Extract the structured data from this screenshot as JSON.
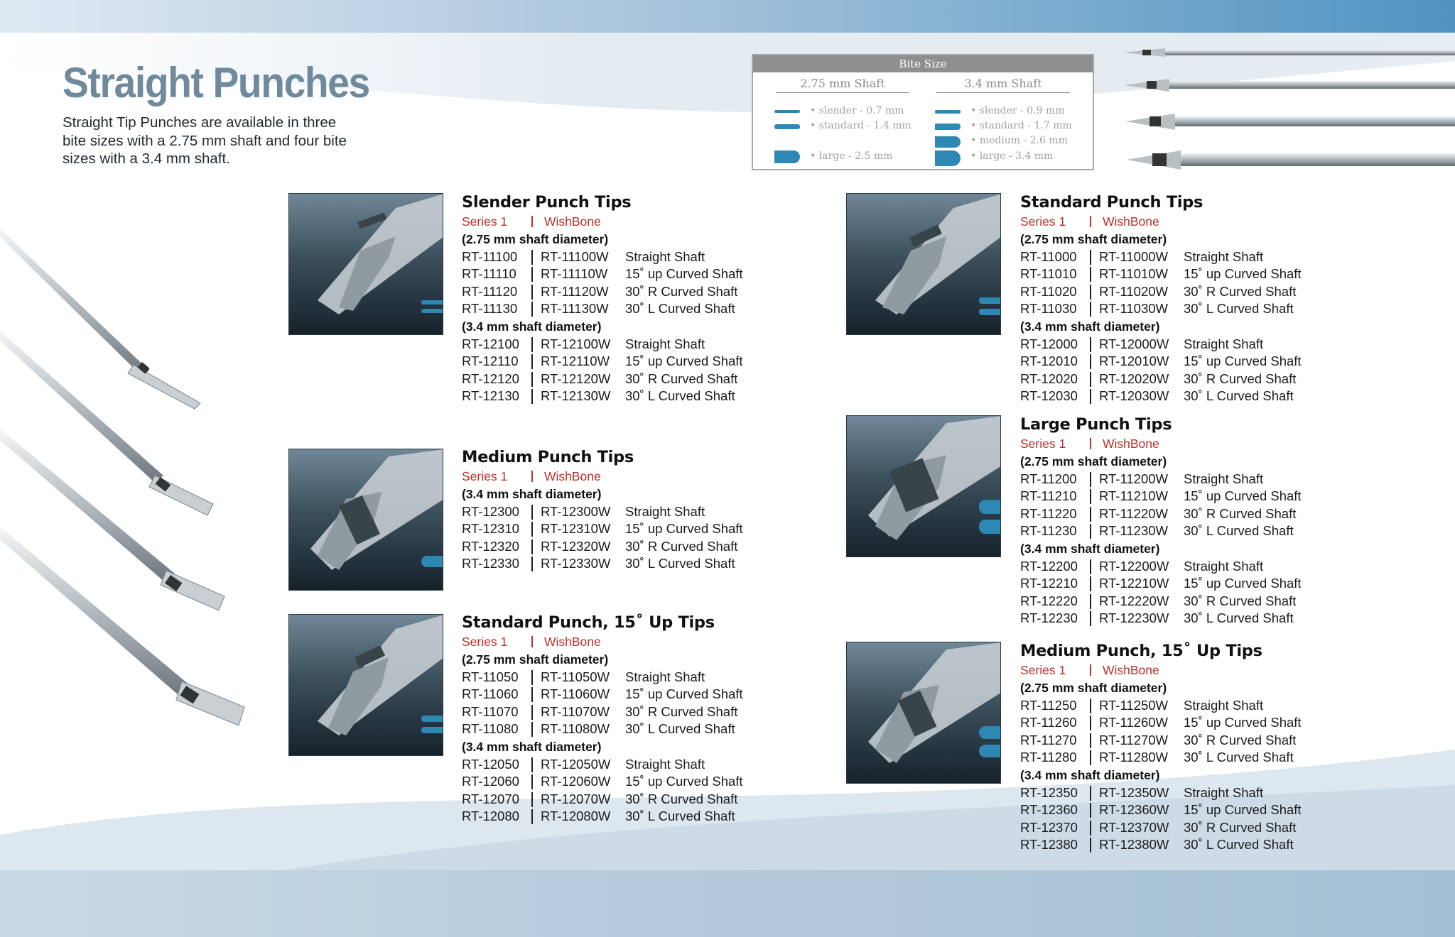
{
  "page": {
    "title": "Straight Punches",
    "intro": "Straight Tip Punches are available in three bite sizes with a 2.75 mm shaft and four bite sizes with a 3.4 mm shaft."
  },
  "bite_size": {
    "header": "Bite Size",
    "columns": [
      {
        "title": "2.75 mm Shaft",
        "items": [
          "• slender - 0.7 mm",
          "• standard - 1.4 mm",
          "• large - 2.5 mm"
        ]
      },
      {
        "title": "3.4 mm Shaft",
        "items": [
          "• slender - 0.9 mm",
          "• standard - 1.7 mm",
          "• medium - 2.6 mm",
          "• large - 3.4 mm"
        ]
      }
    ]
  },
  "colors": {
    "accent": "#2e88b4",
    "series_red": "#b6312c",
    "title_gray": "#6f8a9c"
  },
  "products": [
    {
      "title": "Slender Punch Tips",
      "series1": "Series 1",
      "series2": "WishBone",
      "groups": [
        {
          "heading": "(2.75 mm shaft diameter)",
          "rows": [
            [
              "RT-11100",
              "RT-11100W",
              "Straight Shaft"
            ],
            [
              "RT-11110",
              "RT-11110W",
              "15˚ up Curved Shaft"
            ],
            [
              "RT-11120",
              "RT-11120W",
              "30˚ R Curved Shaft"
            ],
            [
              "RT-11130",
              "RT-11130W",
              "30˚ L Curved Shaft"
            ]
          ]
        },
        {
          "heading": "(3.4 mm shaft diameter)",
          "rows": [
            [
              "RT-12100",
              "RT-12100W",
              "Straight Shaft"
            ],
            [
              "RT-12110",
              "RT-12110W",
              "15˚ up Curved Shaft"
            ],
            [
              "RT-12120",
              "RT-12120W",
              "30˚ R Curved Shaft"
            ],
            [
              "RT-12130",
              "RT-12130W",
              "30˚ L Curved Shaft"
            ]
          ]
        }
      ]
    },
    {
      "title": "Medium Punch Tips",
      "series1": "Series 1",
      "series2": "WishBone",
      "groups": [
        {
          "heading": "(3.4 mm shaft diameter)",
          "rows": [
            [
              "RT-12300",
              "RT-12300W",
              "Straight Shaft"
            ],
            [
              "RT-12310",
              "RT-12310W",
              "15˚ up Curved Shaft"
            ],
            [
              "RT-12320",
              "RT-12320W",
              "30˚ R Curved Shaft"
            ],
            [
              "RT-12330",
              "RT-12330W",
              "30˚ L Curved Shaft"
            ]
          ]
        }
      ]
    },
    {
      "title": "Standard Punch, 15˚ Up Tips",
      "series1": "Series 1",
      "series2": "WishBone",
      "groups": [
        {
          "heading": "(2.75 mm shaft diameter)",
          "rows": [
            [
              "RT-11050",
              "RT-11050W",
              "Straight Shaft"
            ],
            [
              "RT-11060",
              "RT-11060W",
              "15˚ up Curved Shaft"
            ],
            [
              "RT-11070",
              "RT-11070W",
              "30˚ R Curved Shaft"
            ],
            [
              "RT-11080",
              "RT-11080W",
              "30˚ L Curved Shaft"
            ]
          ]
        },
        {
          "heading": "(3.4 mm shaft diameter)",
          "rows": [
            [
              "RT-12050",
              "RT-12050W",
              "Straight Shaft"
            ],
            [
              "RT-12060",
              "RT-12060W",
              "15˚ up Curved Shaft"
            ],
            [
              "RT-12070",
              "RT-12070W",
              "30˚ R Curved Shaft"
            ],
            [
              "RT-12080",
              "RT-12080W",
              "30˚ L Curved Shaft"
            ]
          ]
        }
      ]
    },
    {
      "title": "Standard Punch Tips",
      "series1": "Series 1",
      "series2": "WishBone",
      "groups": [
        {
          "heading": "(2.75 mm shaft diameter)",
          "rows": [
            [
              "RT-11000",
              "RT-11000W",
              "Straight Shaft"
            ],
            [
              "RT-11010",
              "RT-11010W",
              "15˚ up Curved Shaft"
            ],
            [
              "RT-11020",
              "RT-11020W",
              "30˚ R Curved Shaft"
            ],
            [
              "RT-11030",
              "RT-11030W",
              "30˚ L Curved Shaft"
            ]
          ]
        },
        {
          "heading": "(3.4 mm shaft diameter)",
          "rows": [
            [
              "RT-12000",
              "RT-12000W",
              "Straight Shaft"
            ],
            [
              "RT-12010",
              "RT-12010W",
              "15˚ up Curved Shaft"
            ],
            [
              "RT-12020",
              "RT-12020W",
              "30˚ R Curved Shaft"
            ],
            [
              "RT-12030",
              "RT-12030W",
              "30˚ L Curved Shaft"
            ]
          ]
        }
      ]
    },
    {
      "title": "Large Punch Tips",
      "series1": "Series 1",
      "series2": "WishBone",
      "groups": [
        {
          "heading": "(2.75 mm shaft diameter)",
          "rows": [
            [
              "RT-11200",
              "RT-11200W",
              "Straight Shaft"
            ],
            [
              "RT-11210",
              "RT-11210W",
              "15˚ up Curved Shaft"
            ],
            [
              "RT-11220",
              "RT-11220W",
              "30˚ R Curved Shaft"
            ],
            [
              "RT-11230",
              "RT-11230W",
              "30˚ L Curved Shaft"
            ]
          ]
        },
        {
          "heading": "(3.4 mm shaft diameter)",
          "rows": [
            [
              "RT-12200",
              "RT-12200W",
              "Straight Shaft"
            ],
            [
              "RT-12210",
              "RT-12210W",
              "15˚ up Curved Shaft"
            ],
            [
              "RT-12220",
              "RT-12220W",
              "30˚ R Curved Shaft"
            ],
            [
              "RT-12230",
              "RT-12230W",
              "30˚ L Curved Shaft"
            ]
          ]
        }
      ]
    },
    {
      "title": "Medium Punch, 15˚ Up Tips",
      "series1": "Series 1",
      "series2": "WishBone",
      "groups": [
        {
          "heading": "(2.75 mm shaft diameter)",
          "rows": [
            [
              "RT-11250",
              "RT-11250W",
              "Straight Shaft"
            ],
            [
              "RT-11260",
              "RT-11260W",
              "15˚ up Curved Shaft"
            ],
            [
              "RT-11270",
              "RT-11270W",
              "30˚ R Curved Shaft"
            ],
            [
              "RT-11280",
              "RT-11280W",
              "30˚ L Curved Shaft"
            ]
          ]
        },
        {
          "heading": "(3.4 mm shaft diameter)",
          "rows": [
            [
              "RT-12350",
              "RT-12350W",
              "Straight Shaft"
            ],
            [
              "RT-12360",
              "RT-12360W",
              "15˚ up Curved Shaft"
            ],
            [
              "RT-12370",
              "RT-12370W",
              "30˚ R Curved Shaft"
            ],
            [
              "RT-12380",
              "RT-12380W",
              "30˚ L Curved Shaft"
            ]
          ]
        }
      ]
    }
  ]
}
